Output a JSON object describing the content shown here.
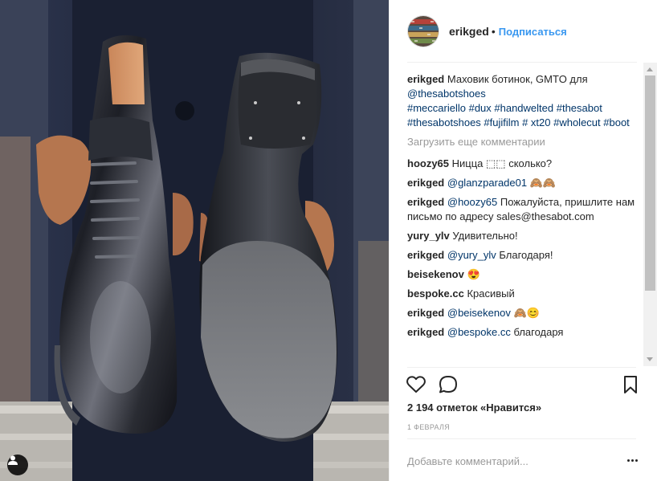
{
  "post": {
    "username": "erikged",
    "separator": "•",
    "follow_label": "Подписаться"
  },
  "caption": {
    "user": "erikged",
    "text": " Маховик ботинок, GMTO для ",
    "mention": "@thesabotshoes",
    "hashtags": "#meccariello #dux #handwelted #thesabot #thesabotshoes #fujifilm # xt20 #wholecut #boot"
  },
  "load_more_label": "Загрузить еще комментарии",
  "comments": [
    {
      "user": "hoozy65",
      "mention": "",
      "text": "Ницца ⬚⬚ сколько?"
    },
    {
      "user": "erikged",
      "mention": "@glanzparade01",
      "text": " 🙈🙈"
    },
    {
      "user": "erikged",
      "mention": "@hoozy65",
      "text": " Пожалуйста, пришлите нам письмо по адресу sales@thesabot.com"
    },
    {
      "user": "yury_ylv",
      "mention": "",
      "text": "Удивительно!"
    },
    {
      "user": "erikged",
      "mention": "@yury_ylv",
      "text": " Благодаря!"
    },
    {
      "user": "beisekenov",
      "mention": "",
      "text": "😍"
    },
    {
      "user": "bespoke.cc",
      "mention": "",
      "text": "Красивый"
    },
    {
      "user": "erikged",
      "mention": "@beisekenov",
      "text": " 🙈😊"
    },
    {
      "user": "erikged",
      "mention": "@bespoke.cc",
      "text": " благодаря"
    }
  ],
  "likes_label": "2 194 отметок «Нравится»",
  "date_label": "1 ФЕВРАЛЯ",
  "add_comment_placeholder": "Добавьте комментарий...",
  "icons": {
    "like": "heart-icon",
    "comment": "comment-icon",
    "save": "bookmark-icon",
    "more": "more-options-icon",
    "user_tag": "user-tag-icon"
  },
  "colors": {
    "link": "#003569",
    "follow": "#3897f0",
    "muted": "#999999"
  }
}
